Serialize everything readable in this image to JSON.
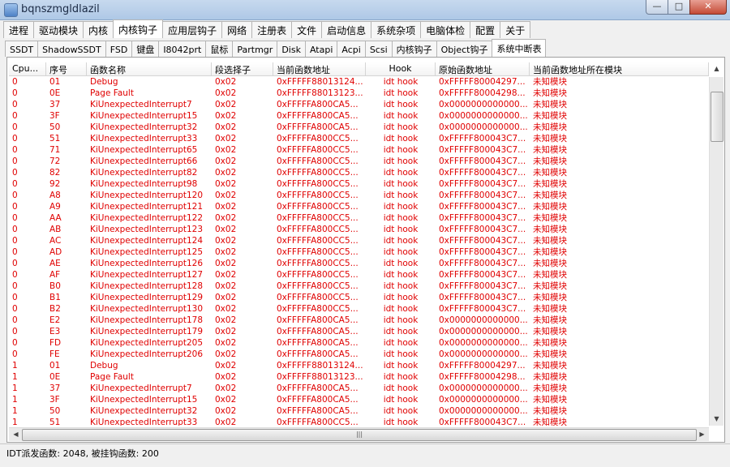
{
  "window": {
    "title": "bqnszmgldlazil",
    "min": "—",
    "max": "□",
    "close": "✕"
  },
  "main_tabs": [
    "进程",
    "驱动模块",
    "内核",
    "内核钩子",
    "应用层钩子",
    "网络",
    "注册表",
    "文件",
    "启动信息",
    "系统杂项",
    "电脑体检",
    "配置",
    "关于"
  ],
  "main_tab_active": 3,
  "sub_tabs": [
    "SSDT",
    "ShadowSSDT",
    "FSD",
    "键盘",
    "I8042prt",
    "鼠标",
    "Partmgr",
    "Disk",
    "Atapi",
    "Acpi",
    "Scsi",
    "内核钩子",
    "Object钩子",
    "系统中断表"
  ],
  "sub_tab_active": 13,
  "columns": [
    "Cpu...",
    "序号",
    "函数名称",
    "段选择子",
    "当前函数地址",
    "Hook",
    "原始函数地址",
    "当前函数地址所在模块"
  ],
  "rows": [
    [
      "0",
      "01",
      "Debug",
      "0x02",
      "0xFFFFF88013124...",
      "idt hook",
      "0xFFFFF80004297...",
      "未知模块"
    ],
    [
      "0",
      "0E",
      "Page Fault",
      "0x02",
      "0xFFFFF88013123...",
      "idt hook",
      "0xFFFFF80004298...",
      "未知模块"
    ],
    [
      "0",
      "37",
      "KiUnexpectedInterrupt7",
      "0x02",
      "0xFFFFFA800CA5...",
      "idt hook",
      "0x0000000000000...",
      "未知模块"
    ],
    [
      "0",
      "3F",
      "KiUnexpectedInterrupt15",
      "0x02",
      "0xFFFFFA800CA5...",
      "idt hook",
      "0x0000000000000...",
      "未知模块"
    ],
    [
      "0",
      "50",
      "KiUnexpectedInterrupt32",
      "0x02",
      "0xFFFFFA800CA5...",
      "idt hook",
      "0x0000000000000...",
      "未知模块"
    ],
    [
      "0",
      "51",
      "KiUnexpectedInterrupt33",
      "0x02",
      "0xFFFFFA800CC5...",
      "idt hook",
      "0xFFFFF800043C7...",
      "未知模块"
    ],
    [
      "0",
      "71",
      "KiUnexpectedInterrupt65",
      "0x02",
      "0xFFFFFA800CC5...",
      "idt hook",
      "0xFFFFF800043C7...",
      "未知模块"
    ],
    [
      "0",
      "72",
      "KiUnexpectedInterrupt66",
      "0x02",
      "0xFFFFFA800CC5...",
      "idt hook",
      "0xFFFFF800043C7...",
      "未知模块"
    ],
    [
      "0",
      "82",
      "KiUnexpectedInterrupt82",
      "0x02",
      "0xFFFFFA800CC5...",
      "idt hook",
      "0xFFFFF800043C7...",
      "未知模块"
    ],
    [
      "0",
      "92",
      "KiUnexpectedInterrupt98",
      "0x02",
      "0xFFFFFA800CC5...",
      "idt hook",
      "0xFFFFF800043C7...",
      "未知模块"
    ],
    [
      "0",
      "A8",
      "KiUnexpectedInterrupt120",
      "0x02",
      "0xFFFFFA800CC5...",
      "idt hook",
      "0xFFFFF800043C7...",
      "未知模块"
    ],
    [
      "0",
      "A9",
      "KiUnexpectedInterrupt121",
      "0x02",
      "0xFFFFFA800CC5...",
      "idt hook",
      "0xFFFFF800043C7...",
      "未知模块"
    ],
    [
      "0",
      "AA",
      "KiUnexpectedInterrupt122",
      "0x02",
      "0xFFFFFA800CC5...",
      "idt hook",
      "0xFFFFF800043C7...",
      "未知模块"
    ],
    [
      "0",
      "AB",
      "KiUnexpectedInterrupt123",
      "0x02",
      "0xFFFFFA800CC5...",
      "idt hook",
      "0xFFFFF800043C7...",
      "未知模块"
    ],
    [
      "0",
      "AC",
      "KiUnexpectedInterrupt124",
      "0x02",
      "0xFFFFFA800CC5...",
      "idt hook",
      "0xFFFFF800043C7...",
      "未知模块"
    ],
    [
      "0",
      "AD",
      "KiUnexpectedInterrupt125",
      "0x02",
      "0xFFFFFA800CC5...",
      "idt hook",
      "0xFFFFF800043C7...",
      "未知模块"
    ],
    [
      "0",
      "AE",
      "KiUnexpectedInterrupt126",
      "0x02",
      "0xFFFFFA800CC5...",
      "idt hook",
      "0xFFFFF800043C7...",
      "未知模块"
    ],
    [
      "0",
      "AF",
      "KiUnexpectedInterrupt127",
      "0x02",
      "0xFFFFFA800CC5...",
      "idt hook",
      "0xFFFFF800043C7...",
      "未知模块"
    ],
    [
      "0",
      "B0",
      "KiUnexpectedInterrupt128",
      "0x02",
      "0xFFFFFA800CC5...",
      "idt hook",
      "0xFFFFF800043C7...",
      "未知模块"
    ],
    [
      "0",
      "B1",
      "KiUnexpectedInterrupt129",
      "0x02",
      "0xFFFFFA800CC5...",
      "idt hook",
      "0xFFFFF800043C7...",
      "未知模块"
    ],
    [
      "0",
      "B2",
      "KiUnexpectedInterrupt130",
      "0x02",
      "0xFFFFFA800CC5...",
      "idt hook",
      "0xFFFFF800043C7...",
      "未知模块"
    ],
    [
      "0",
      "E2",
      "KiUnexpectedInterrupt178",
      "0x02",
      "0xFFFFFA800CA5...",
      "idt hook",
      "0x0000000000000...",
      "未知模块"
    ],
    [
      "0",
      "E3",
      "KiUnexpectedInterrupt179",
      "0x02",
      "0xFFFFFA800CA5...",
      "idt hook",
      "0x0000000000000...",
      "未知模块"
    ],
    [
      "0",
      "FD",
      "KiUnexpectedInterrupt205",
      "0x02",
      "0xFFFFFA800CA5...",
      "idt hook",
      "0x0000000000000...",
      "未知模块"
    ],
    [
      "0",
      "FE",
      "KiUnexpectedInterrupt206",
      "0x02",
      "0xFFFFFA800CA5...",
      "idt hook",
      "0x0000000000000...",
      "未知模块"
    ],
    [
      "1",
      "01",
      "Debug",
      "0x02",
      "0xFFFFF88013124...",
      "idt hook",
      "0xFFFFF80004297...",
      "未知模块"
    ],
    [
      "1",
      "0E",
      "Page Fault",
      "0x02",
      "0xFFFFF88013123...",
      "idt hook",
      "0xFFFFF80004298...",
      "未知模块"
    ],
    [
      "1",
      "37",
      "KiUnexpectedInterrupt7",
      "0x02",
      "0xFFFFFA800CA5...",
      "idt hook",
      "0x0000000000000...",
      "未知模块"
    ],
    [
      "1",
      "3F",
      "KiUnexpectedInterrupt15",
      "0x02",
      "0xFFFFFA800CA5...",
      "idt hook",
      "0x0000000000000...",
      "未知模块"
    ],
    [
      "1",
      "50",
      "KiUnexpectedInterrupt32",
      "0x02",
      "0xFFFFFA800CA5...",
      "idt hook",
      "0x0000000000000...",
      "未知模块"
    ],
    [
      "1",
      "51",
      "KiUnexpectedInterrupt33",
      "0x02",
      "0xFFFFFA800CC5...",
      "idt hook",
      "0xFFFFF800043C7...",
      "未知模块"
    ]
  ],
  "status": "IDT派发函数:  2048, 被挂钩函数:  200",
  "colors": {
    "row_text": "#e00000"
  }
}
